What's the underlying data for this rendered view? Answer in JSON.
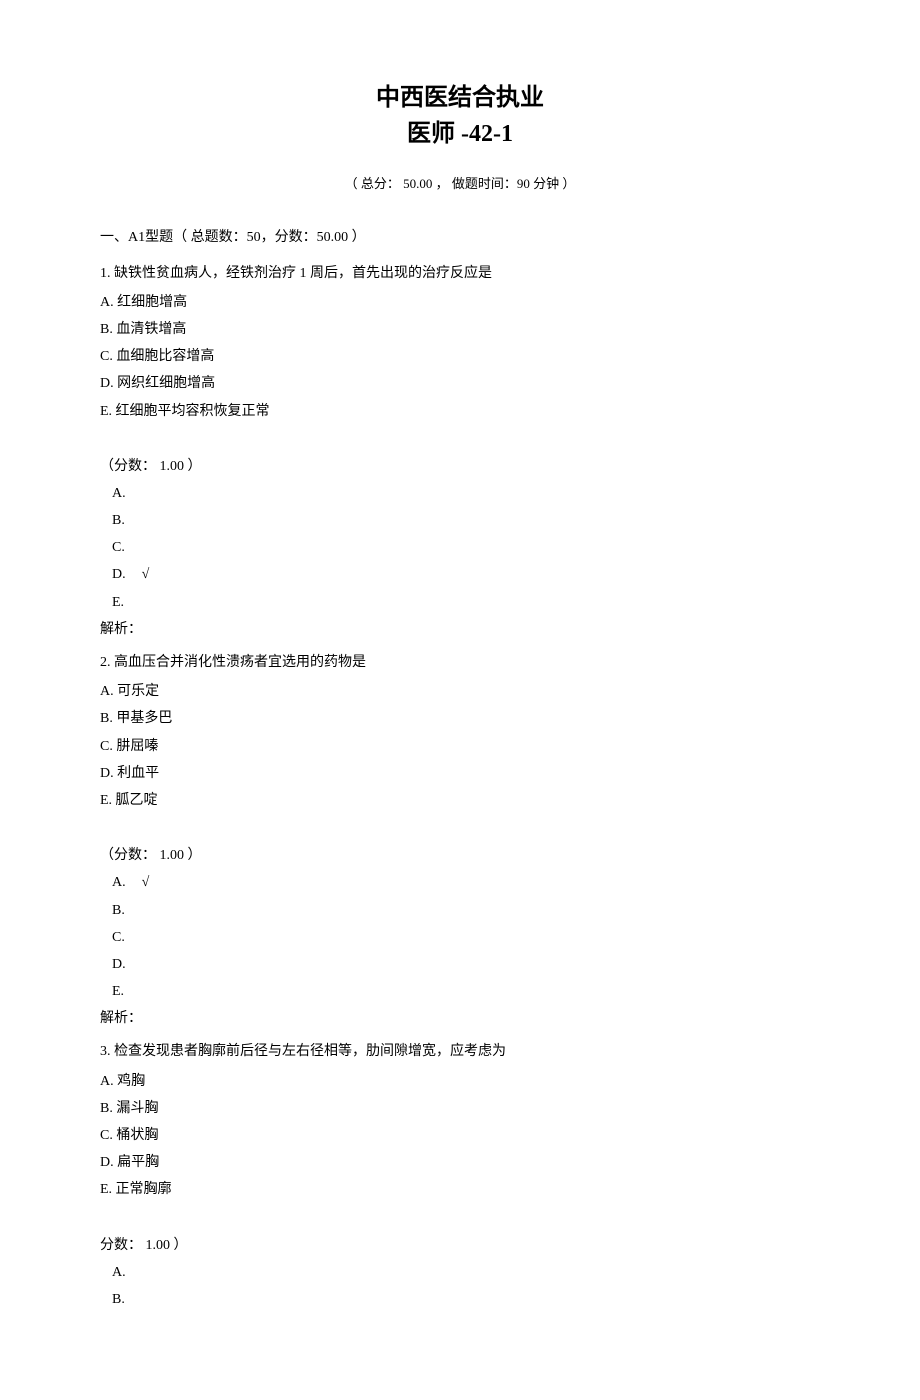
{
  "title_line1": "中西医结合执业",
  "title_line2": "医师 -42-1",
  "meta": "（ 总分： 50.00 ， 做题时间：90 分钟 ）",
  "section_header": "一、A1型题（ 总题数：50，分数：50.00 ）",
  "questions": [
    {
      "number": "1.",
      "stem": "缺铁性贫血病人，经铁剂治疗  1 周后，首先出现的治疗反应是",
      "options": {
        "A": "红细胞增高",
        "B": "血清铁增高",
        "C": "血细胞比容增高",
        "D": "网织红细胞增高",
        "E": "红细胞平均容积恢复正常"
      },
      "score_label": "（分数：  1.00 ）",
      "answers": [
        "A.",
        "B.",
        "C.",
        "D.",
        "E."
      ],
      "correct_index": 3,
      "correct_mark": "√",
      "analysis_label": "解析："
    },
    {
      "number": "2.",
      "stem": "高血压合并消化性溃疡者宜选用的药物是",
      "options": {
        "A": "可乐定",
        "B": "甲基多巴",
        "C": "肼屈嗪",
        "D": "利血平",
        "E": "胍乙啶"
      },
      "score_label": "（分数：  1.00 ）",
      "answers": [
        "A.",
        "B.",
        "C.",
        "D.",
        "E."
      ],
      "correct_index": 0,
      "correct_mark": "√",
      "analysis_label": "解析："
    },
    {
      "number": "3.",
      "stem": "检查发现患者胸廓前后径与左右径相等，肋间隙增宽，应考虑为",
      "options": {
        "A": "鸡胸",
        "B": "漏斗胸",
        "C": "桶状胸",
        "D": "扁平胸",
        "E": "正常胸廓"
      },
      "score_label": "分数：  1.00 ）",
      "answers": [
        "A.",
        "B."
      ],
      "correct_index": -1,
      "correct_mark": "",
      "analysis_label": ""
    }
  ]
}
